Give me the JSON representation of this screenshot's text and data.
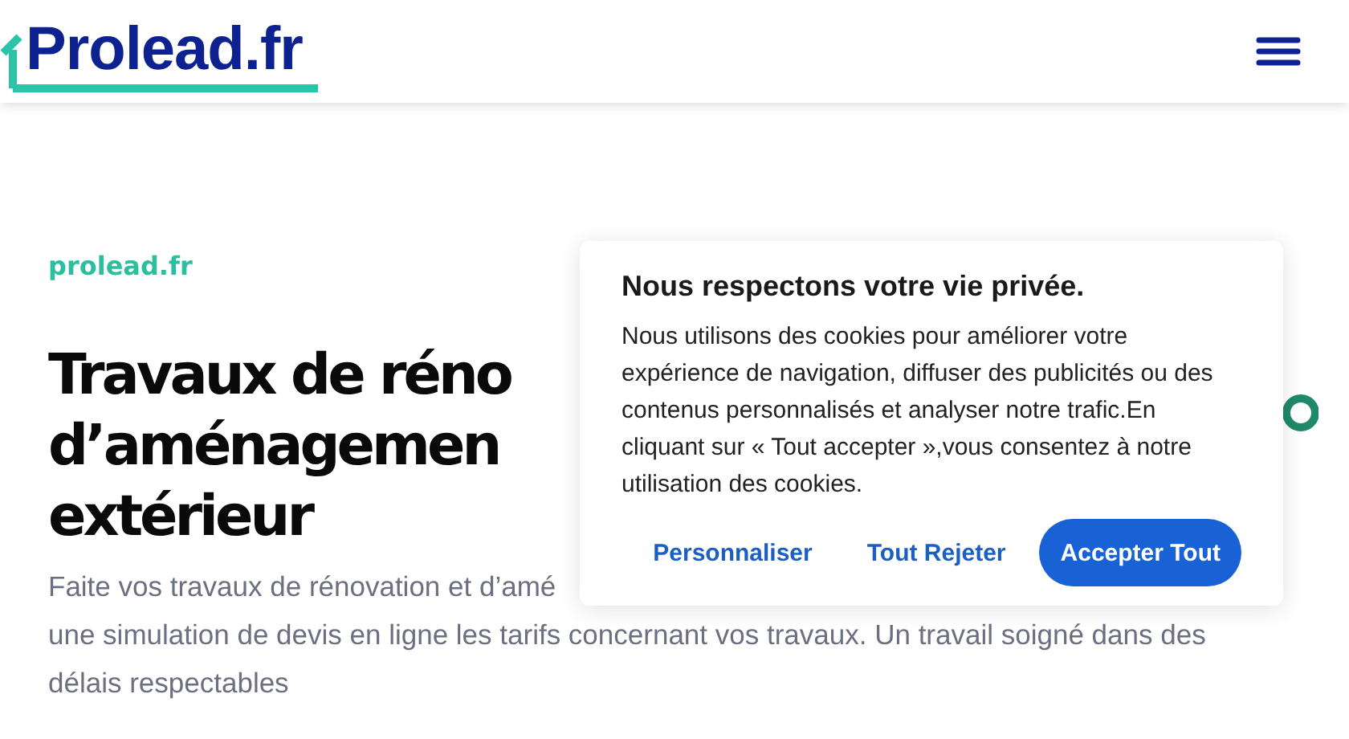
{
  "header": {
    "logo": "Prolead.fr"
  },
  "hero": {
    "eyebrow": "prolead.fr",
    "heading_lines": [
      "Travaux de réno",
      "d’aménagemen",
      "extérieur"
    ],
    "description_lines": [
      "Faite vos travaux de rénovation et d’amé",
      "une simulation de devis en ligne les tarifs concernant vos travaux. Un travail soigné dans des",
      "délais respectables"
    ]
  },
  "cookie_dialog": {
    "title": "Nous respectons votre vie privée.",
    "text": "Nous utilisons des cookies pour améliorer votre expérience de navigation, diffuser des publicités ou des contenus personnalisés et analyser notre trafic.En cliquant sur « Tout accepter »,vous consentez à notre utilisation des cookies.",
    "buttons": [
      {
        "label": "Personnaliser",
        "kind": "link"
      },
      {
        "label": "Tout Rejeter",
        "kind": "link"
      },
      {
        "label": "Accepter Tout",
        "kind": "primary"
      }
    ]
  }
}
